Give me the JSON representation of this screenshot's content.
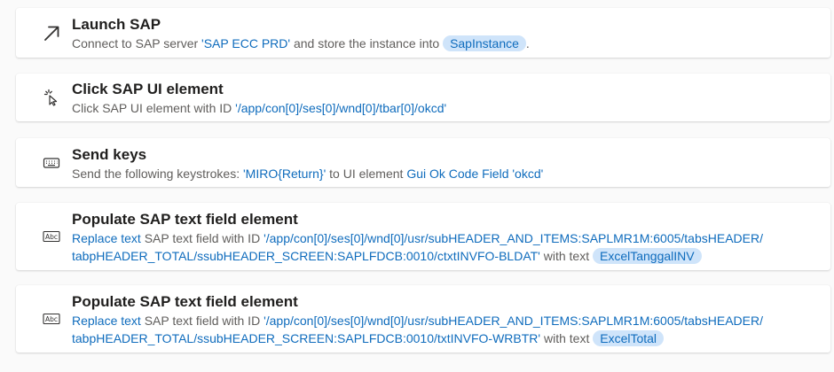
{
  "actions": [
    {
      "icon": "arrow-up-right-icon",
      "title": "Launch SAP",
      "desc": {
        "t1": "Connect to SAP server ",
        "server": "'SAP ECC PRD'",
        "t2": " and store the instance into ",
        "var": "SapInstance",
        "t3": "."
      }
    },
    {
      "icon": "click-cursor-icon",
      "title": "Click SAP UI element",
      "desc": {
        "t1": "Click SAP UI element with ID ",
        "id": "'/app/con[0]/ses[0]/wnd[0]/tbar[0]/okcd'"
      }
    },
    {
      "icon": "keyboard-icon",
      "title": "Send keys",
      "desc": {
        "t1": "Send the following keystrokes: ",
        "keys": "'MIRO{Return}'",
        "t2": " to UI element ",
        "element": "Gui Ok Code Field 'okcd'"
      }
    },
    {
      "icon": "text-field-icon",
      "title": "Populate SAP text field element",
      "desc": {
        "mode": "Replace text",
        "t1": " SAP text field with ID ",
        "id_line1": "'/app/con[0]/ses[0]/wnd[0]/usr/subHEADER_AND_ITEMS:SAPLMR1M:6005/tabsHEADER/",
        "id_line2": "tabpHEADER_TOTAL/ssubHEADER_SCREEN:SAPLFDCB:0010/ctxtINVFO-BLDAT'",
        "t2": " with text ",
        "var": "ExcelTanggalINV"
      }
    },
    {
      "icon": "text-field-icon",
      "title": "Populate SAP text field element",
      "desc": {
        "mode": "Replace text",
        "t1": " SAP text field with ID ",
        "id_line1": "'/app/con[0]/ses[0]/wnd[0]/usr/subHEADER_AND_ITEMS:SAPLMR1M:6005/tabsHEADER/",
        "id_line2": "tabpHEADER_TOTAL/ssubHEADER_SCREEN:SAPLFDCB:0010/txtINVFO-WRBTR'",
        "t2": " with text ",
        "var": "ExcelTotal"
      }
    }
  ],
  "colors": {
    "link": "#0f6cbd",
    "chip_bg": "#cfe4fa",
    "description": "#605e5c",
    "title": "#201f1e"
  }
}
